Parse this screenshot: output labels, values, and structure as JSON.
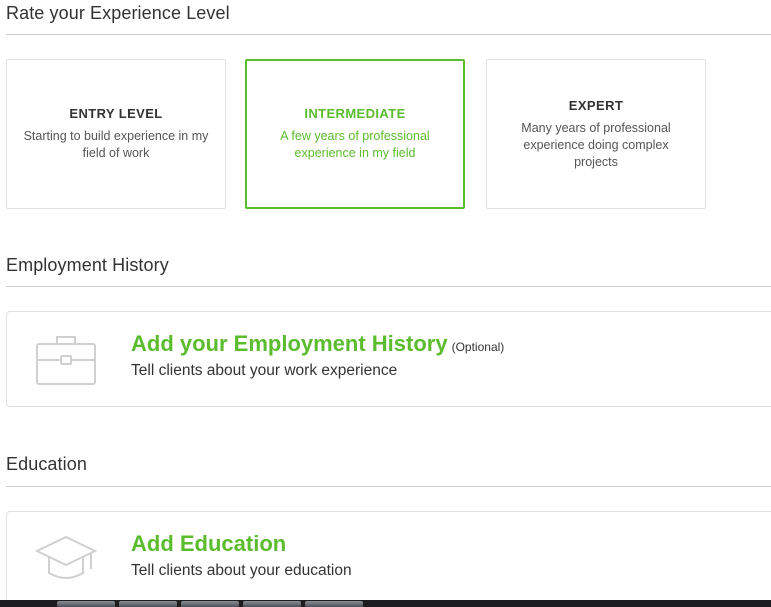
{
  "experience": {
    "heading": "Rate your Experience Level",
    "levels": [
      {
        "title": "ENTRY LEVEL",
        "description": "Starting to build experience in my field of work",
        "selected": false
      },
      {
        "title": "INTERMEDIATE",
        "description": "A few years of professional experience in my field",
        "selected": true
      },
      {
        "title": "EXPERT",
        "description": "Many years of professional experience doing complex projects",
        "selected": false
      }
    ]
  },
  "employment": {
    "heading": "Employment History",
    "card_title": "Add your Employment History",
    "optional_label": "(Optional)",
    "card_subtitle": "Tell clients about your work experience",
    "icon": "briefcase-icon"
  },
  "education": {
    "heading": "Education",
    "card_title": "Add Education",
    "card_subtitle": "Tell clients about your education",
    "icon": "graduation-cap-icon"
  },
  "colors": {
    "accent": "#5bbc2e",
    "border": "#e0e0e0",
    "icon": "#d0d0d0"
  }
}
